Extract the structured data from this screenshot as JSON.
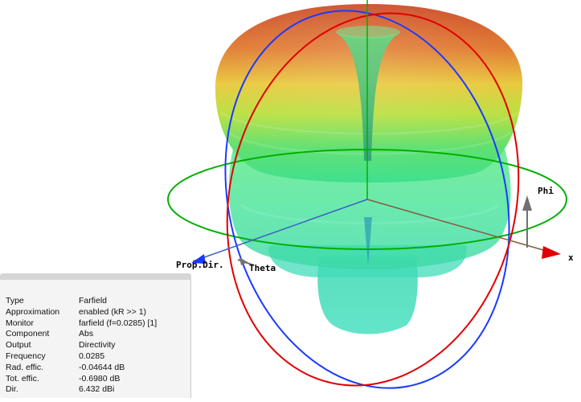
{
  "viewport": {
    "axis_labels": {
      "x": "x",
      "phi": "Phi",
      "theta": "Theta",
      "prop_dir": "Prop.Dir."
    },
    "colors": {
      "background": "#ffffff",
      "x_axis": "#e00000",
      "y_axis": "#00b000",
      "z_axis": "#1a3aff",
      "arrow_gray": "#707070",
      "pattern_high": "#d43a1a",
      "pattern_mid": "#f0d030",
      "pattern_low": "#40e890",
      "pattern_base": "#40dcb0"
    }
  },
  "info_panel": {
    "rows": [
      {
        "key": "Type",
        "value": "Farfield"
      },
      {
        "key": "Approximation",
        "value": "enabled (kR >> 1)"
      },
      {
        "key": "Monitor",
        "value": "farfield (f=0.0285) [1]"
      },
      {
        "key": "Component",
        "value": "Abs"
      },
      {
        "key": "Output",
        "value": "Directivity"
      },
      {
        "key": "Frequency",
        "value": "0.0285"
      },
      {
        "key": "Rad. effic.",
        "value": "-0.04644 dB"
      },
      {
        "key": "Tot. effic.",
        "value": "-0.6980 dB"
      },
      {
        "key": "Dir.",
        "value": "6.432 dBi"
      }
    ]
  }
}
